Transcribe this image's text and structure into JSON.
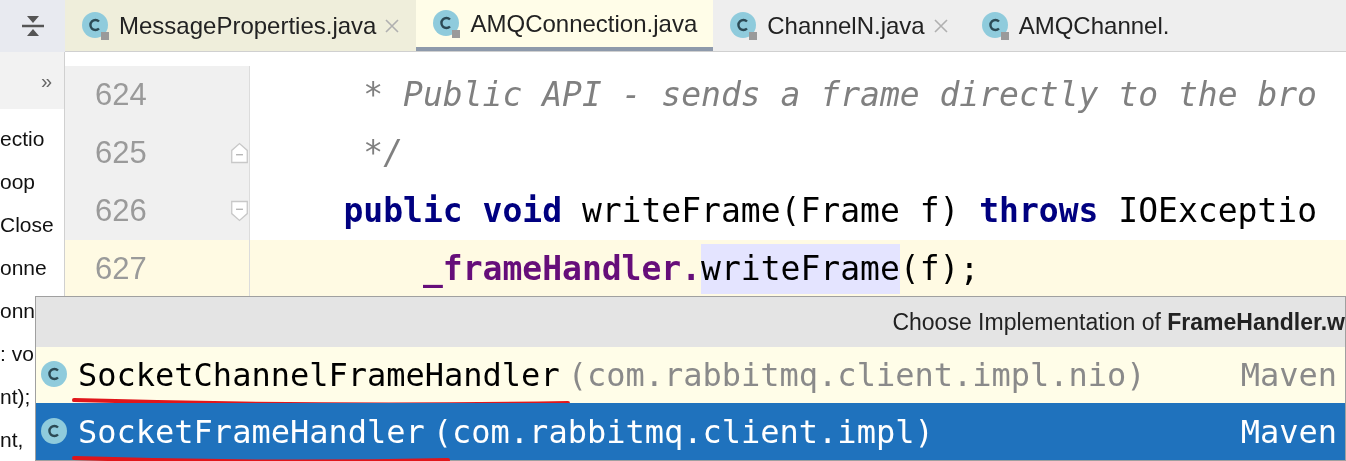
{
  "tabs": [
    {
      "label": "MessageProperties.java",
      "selected": false,
      "closable": true
    },
    {
      "label": "AMQConnection.java",
      "selected": true,
      "closable": false
    },
    {
      "label": "ChannelN.java",
      "selected": false,
      "closable": true
    },
    {
      "label": "AMQChannel.",
      "selected": false,
      "closable": false
    }
  ],
  "sidebar": {
    "expand": "»",
    "items": [
      "ectio",
      "oop",
      "Close",
      "onne",
      "onn",
      ": vo",
      "nt);",
      "nt,"
    ]
  },
  "editor": {
    "lines": [
      {
        "number": "624",
        "kind": "plain",
        "current": false,
        "segments": [
          {
            "text": "     * Public API - sends a frame directly to the bro",
            "kind": "comment"
          }
        ]
      },
      {
        "number": "625",
        "kind": "fold-end",
        "current": false,
        "segments": [
          {
            "text": "     */",
            "kind": "comment"
          }
        ]
      },
      {
        "number": "626",
        "kind": "fold-start",
        "current": false,
        "segments": [
          {
            "text": "    public void",
            "kind": "keyword"
          },
          {
            "text": " writeFrame(Frame f) ",
            "kind": "plain"
          },
          {
            "text": "throws",
            "kind": "keyword"
          },
          {
            "text": " IOExceptio",
            "kind": "plain"
          }
        ]
      },
      {
        "number": "627",
        "kind": "plain",
        "current": true,
        "segments": [
          {
            "text": "        _frameHandler.",
            "kind": "field"
          },
          {
            "text": "writeFrame",
            "kind": "usage"
          },
          {
            "text": "(f);",
            "kind": "plain"
          }
        ]
      }
    ]
  },
  "popup": {
    "title": "Choose Implementation of **FrameHandler.w**",
    "items": [
      {
        "name": "SocketChannelFrameHandler",
        "package": "(com.rabbitmq.client.impl.nio)",
        "source": "Maven",
        "selected": false,
        "underlined": true
      },
      {
        "name": "SocketFrameHandler",
        "package": "(com.rabbitmq.client.impl)",
        "source": "Maven",
        "selected": true,
        "underlined": true
      }
    ]
  }
}
